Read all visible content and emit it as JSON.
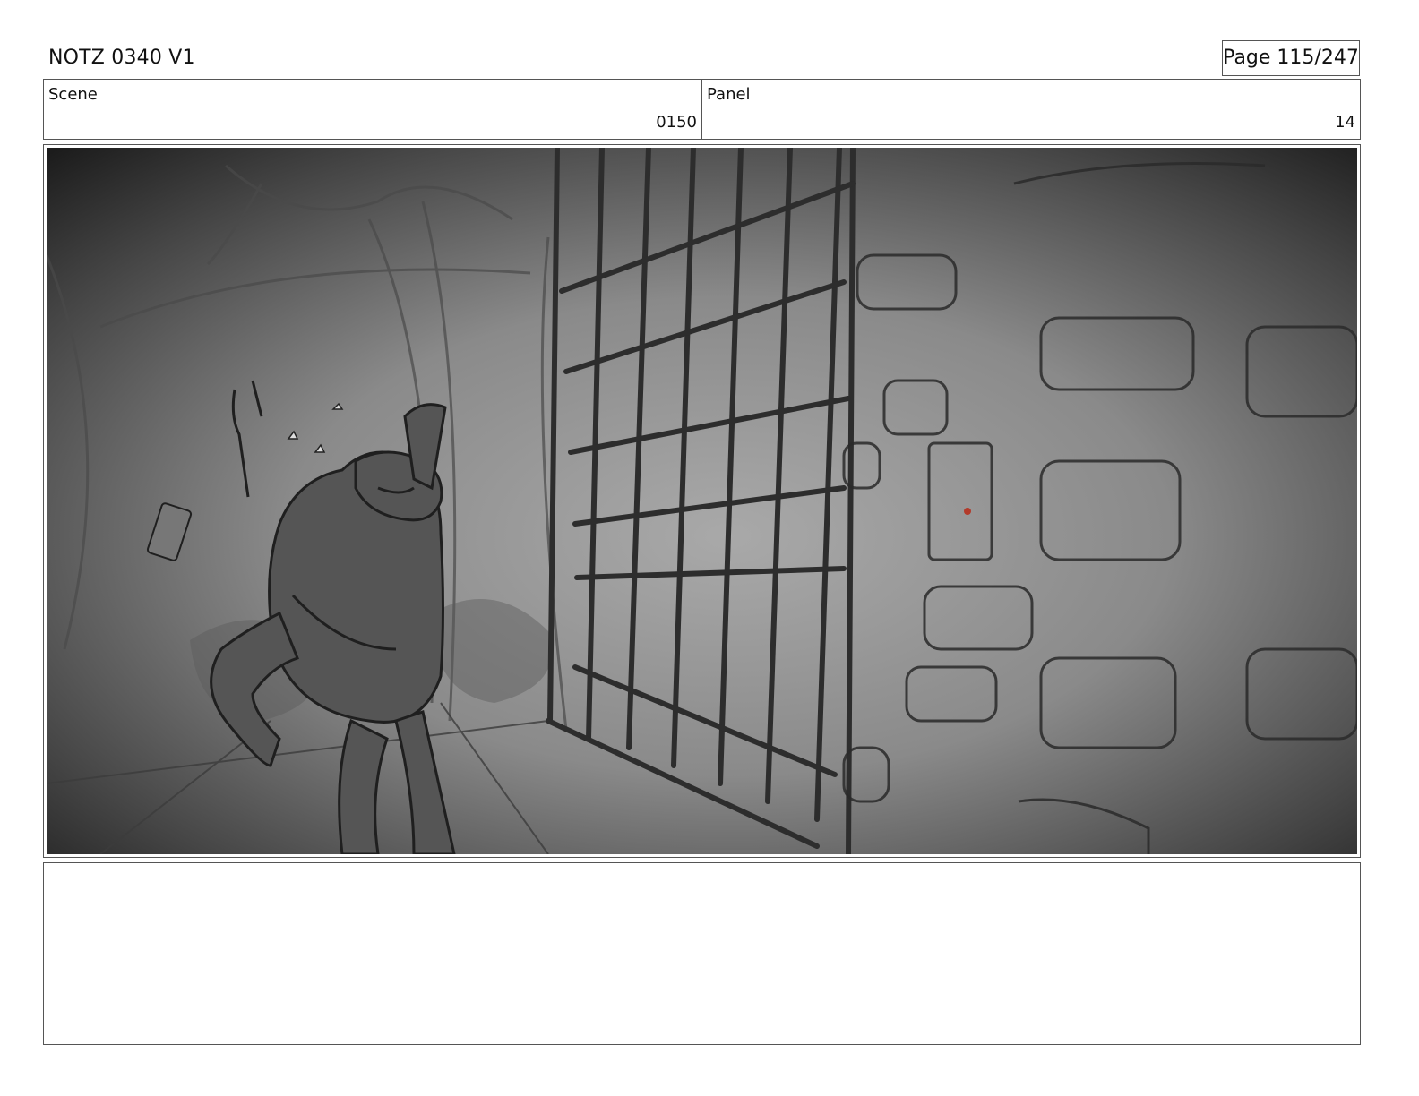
{
  "header": {
    "title": "NOTZ 0340 V1",
    "page": "Page 115/247"
  },
  "info": {
    "scene_label": "Scene",
    "scene_value": "0150",
    "panel_label": "Panel",
    "panel_value": "14"
  },
  "notes": {
    "text": ""
  }
}
